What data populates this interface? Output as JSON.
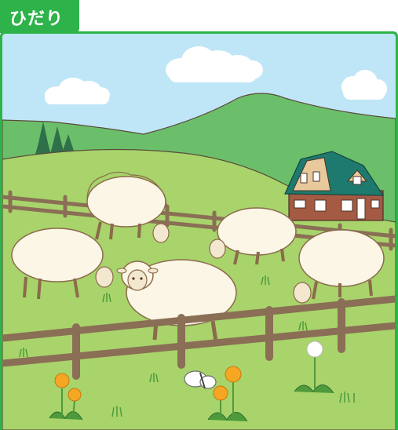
{
  "header": {
    "title": "ひだり"
  },
  "illustration": {
    "subject": "sheep-grazing-pasture"
  },
  "colors": {
    "tag_green": "#2db34a",
    "sky": "#bfe6f6",
    "grass": "#a8d46b",
    "hill": "#6cbf6a",
    "fence": "#8a6e55",
    "barn_roof": "#1e7a6e",
    "barn_wall": "#a55a43",
    "dandelion": "#f5a623"
  }
}
